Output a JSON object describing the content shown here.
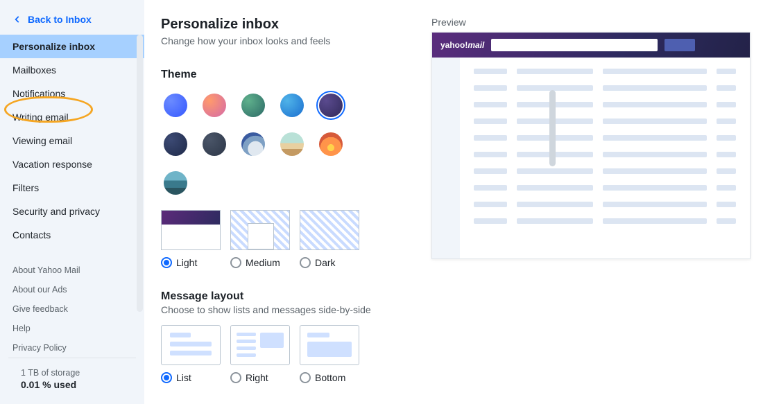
{
  "back_link": "Back to Inbox",
  "sidebar": {
    "items": [
      {
        "label": "Personalize inbox",
        "active": true
      },
      {
        "label": "Mailboxes"
      },
      {
        "label": "Notifications"
      },
      {
        "label": "Writing email"
      },
      {
        "label": "Viewing email"
      },
      {
        "label": "Vacation response"
      },
      {
        "label": "Filters"
      },
      {
        "label": "Security and privacy"
      },
      {
        "label": "Contacts"
      }
    ],
    "about": [
      "About Yahoo Mail",
      "About our Ads",
      "Give feedback",
      "Help",
      "Privacy Policy"
    ],
    "storage_label": "1 TB of storage",
    "storage_used": "0.01 % used"
  },
  "page": {
    "title": "Personalize inbox",
    "subtitle": "Change how your inbox looks and feels"
  },
  "theme": {
    "heading": "Theme",
    "swatches": [
      {
        "name": "blue",
        "css": "radial-gradient(circle at 30% 30%, #6b8bff, #3558ff)"
      },
      {
        "name": "sunset",
        "css": "radial-gradient(circle at 30% 30%, #ff9a6c, #d46aa8)"
      },
      {
        "name": "forest",
        "css": "radial-gradient(circle at 30% 30%, #5fb08c, #2c6a66)"
      },
      {
        "name": "ocean",
        "css": "radial-gradient(circle at 30% 30%, #4fb3e8, #1b6fd0)"
      },
      {
        "name": "indigo",
        "css": "radial-gradient(circle at 30% 30%, #5a4a8e, #312a5a)",
        "selected": true
      },
      {
        "name": "navy",
        "css": "radial-gradient(circle at 30% 30%, #3c4a74, #1f2a49)"
      },
      {
        "name": "slate",
        "css": "radial-gradient(circle at 30% 30%, #4a5568, #2d3748)"
      },
      {
        "name": "mountain",
        "css": "radial-gradient(circle at 60% 70%, #e0e8f0 0 35%, #7ea0c4 36% 60%, #3a5ba0 61%)"
      },
      {
        "name": "beach",
        "css": "linear-gradient(180deg,#b9e1d7 0 45%,#e8d0a0 45% 70%,#c49a62 70%)"
      },
      {
        "name": "dusk",
        "css": "radial-gradient(circle at 50% 65%, #ffd24a 0 18%, #ff944a 18% 55%, #d65a3a 55%)"
      },
      {
        "name": "lake",
        "css": "linear-gradient(180deg,#6fb4c8 0 40%,#3a7a8c 40% 70%,#2a5560 70%)"
      }
    ],
    "modes": [
      {
        "value": "light",
        "label": "Light",
        "selected": true
      },
      {
        "value": "medium",
        "label": "Medium"
      },
      {
        "value": "dark",
        "label": "Dark"
      }
    ]
  },
  "layout": {
    "heading": "Message layout",
    "subtitle": "Choose to show lists and messages side-by-side",
    "options": [
      {
        "value": "list",
        "label": "List",
        "selected": true
      },
      {
        "value": "right",
        "label": "Right"
      },
      {
        "value": "bottom",
        "label": "Bottom"
      }
    ]
  },
  "preview": {
    "label": "Preview",
    "logo_a": "yahoo!",
    "logo_b": "mail"
  },
  "annotation": {
    "highlighted_item_index": 3
  }
}
